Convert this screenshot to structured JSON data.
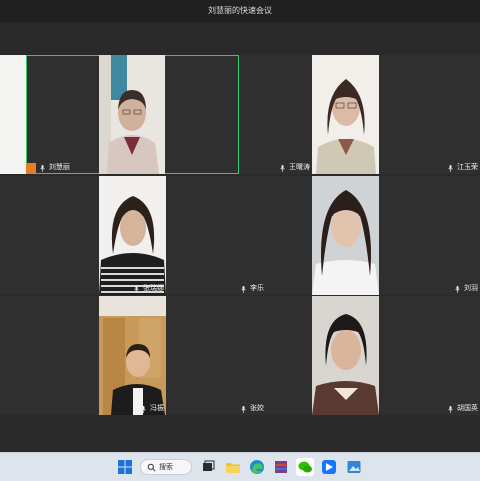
{
  "window": {
    "title": "刘慧丽的快速会议"
  },
  "participants": [
    {
      "name": "刘慧丽",
      "active": true,
      "sharing": true
    },
    {
      "name": "王曙涛"
    },
    {
      "name": "江玉荣"
    },
    {
      "name": "张瑞娜"
    },
    {
      "name": "李乐"
    },
    {
      "name": "刘羽"
    },
    {
      "name": "冯振"
    },
    {
      "name": "张姣"
    },
    {
      "name": "胡国英"
    }
  ],
  "taskbar": {
    "search_label": "搜索",
    "icons": [
      "windows-start-icon",
      "search-icon",
      "task-view-icon",
      "file-explorer-icon",
      "edge-browser-icon",
      "winrar-icon",
      "wechat-icon",
      "meeting-app-icon",
      "photos-icon"
    ]
  }
}
